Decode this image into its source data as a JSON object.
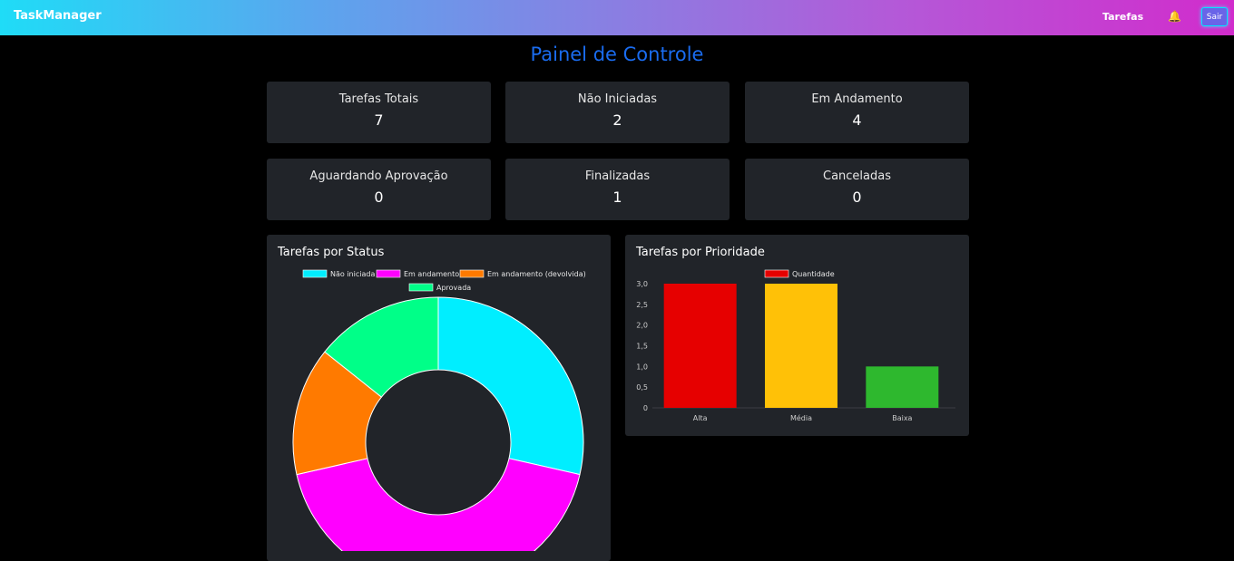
{
  "navbar": {
    "brand": "TaskManager",
    "tasks_link": "Tarefas",
    "logout_label": "Sair",
    "gradient": [
      "#1fdcf7",
      "#d12ccc"
    ]
  },
  "page_title": "Painel de Controle",
  "stats": [
    {
      "label": "Tarefas Totais",
      "value": "7"
    },
    {
      "label": "Não Iniciadas",
      "value": "2"
    },
    {
      "label": "Em Andamento",
      "value": "4"
    },
    {
      "label": "Aguardando Aprovação",
      "value": "0"
    },
    {
      "label": "Finalizadas",
      "value": "1"
    },
    {
      "label": "Canceladas",
      "value": "0"
    }
  ],
  "chart_data": [
    {
      "type": "pie",
      "title": "Tarefas por Status",
      "variant": "doughnut",
      "legend_position": "top",
      "categories": [
        "Não iniciada",
        "Em andamento",
        "Em andamento (devolvida)",
        "Aprovada"
      ],
      "values": [
        2,
        3,
        1,
        1
      ],
      "colors": [
        "#00eeff",
        "#ff00ff",
        "#ff7a00",
        "#00ff88"
      ]
    },
    {
      "type": "bar",
      "title": "Tarefas por Prioridade",
      "categories": [
        "Alta",
        "Média",
        "Baixa"
      ],
      "series": [
        {
          "name": "Quantidade",
          "values": [
            3,
            3,
            1
          ]
        }
      ],
      "colors": [
        "#e60000",
        "#ffc107",
        "#2eb82e"
      ],
      "ylim": [
        0,
        3
      ],
      "yticks": [
        "0",
        "0,5",
        "1,0",
        "1,5",
        "2,0",
        "2,5",
        "3,0"
      ],
      "legend_position": "top",
      "grid": false
    }
  ]
}
